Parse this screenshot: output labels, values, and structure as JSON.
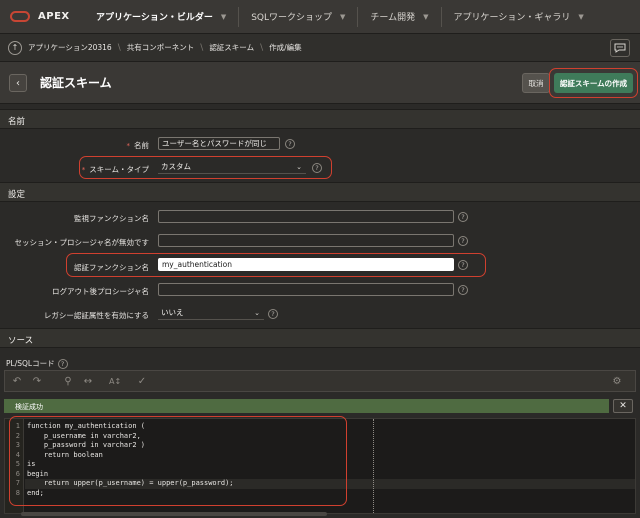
{
  "nav": {
    "brand": "APEX",
    "tabs": [
      "アプリケーション・ビルダー",
      "SQLワークショップ",
      "チーム開発",
      "アプリケーション・ギャラリ"
    ]
  },
  "breadcrumb": [
    "アプリケーション20316",
    "共有コンポーネント",
    "認証スキーム",
    "作成/編集"
  ],
  "page": {
    "title": "認証スキーム",
    "cancel_label": "取消",
    "create_label": "認証スキームの作成"
  },
  "sections": {
    "name": "名前",
    "settings": "設定",
    "source": "ソース"
  },
  "fields": {
    "name_label": "名前",
    "name_value": "ユーザー名とパスワードが同じ",
    "scheme_type_label": "スキーム・タイプ",
    "scheme_type_value": "カスタム",
    "sentry_label": "監視ファンクション名",
    "sentry_value": "",
    "invalid_session_label": "セッション・プロシージャ名が無効です",
    "invalid_session_value": "",
    "auth_function_label": "認証ファンクション名",
    "auth_function_value": "my_authentication",
    "post_logout_label": "ログアウト後プロシージャ名",
    "post_logout_value": "",
    "legacy_label": "レガシー認証属性を有効にする",
    "legacy_value": "いいえ",
    "required_mark": "*",
    "help_mark": "?"
  },
  "source": {
    "plsql_label": "PL/SQLコード",
    "status": "検証成功",
    "line_numbers": [
      "1",
      "2",
      "3",
      "4",
      "5",
      "6",
      "7",
      "8"
    ],
    "code_lines": [
      "function my_authentication (",
      "    p_username in varchar2,",
      "    p_password in varchar2 )",
      "    return boolean",
      "is",
      "begin",
      "    return upper(p_username) = upper(p_password);",
      "end;"
    ]
  },
  "colors": {
    "accent_green": "#3f7b5a",
    "highlight_red": "#d0402f",
    "success_bar": "#4f6b41",
    "oracle_red": "#c74634"
  }
}
